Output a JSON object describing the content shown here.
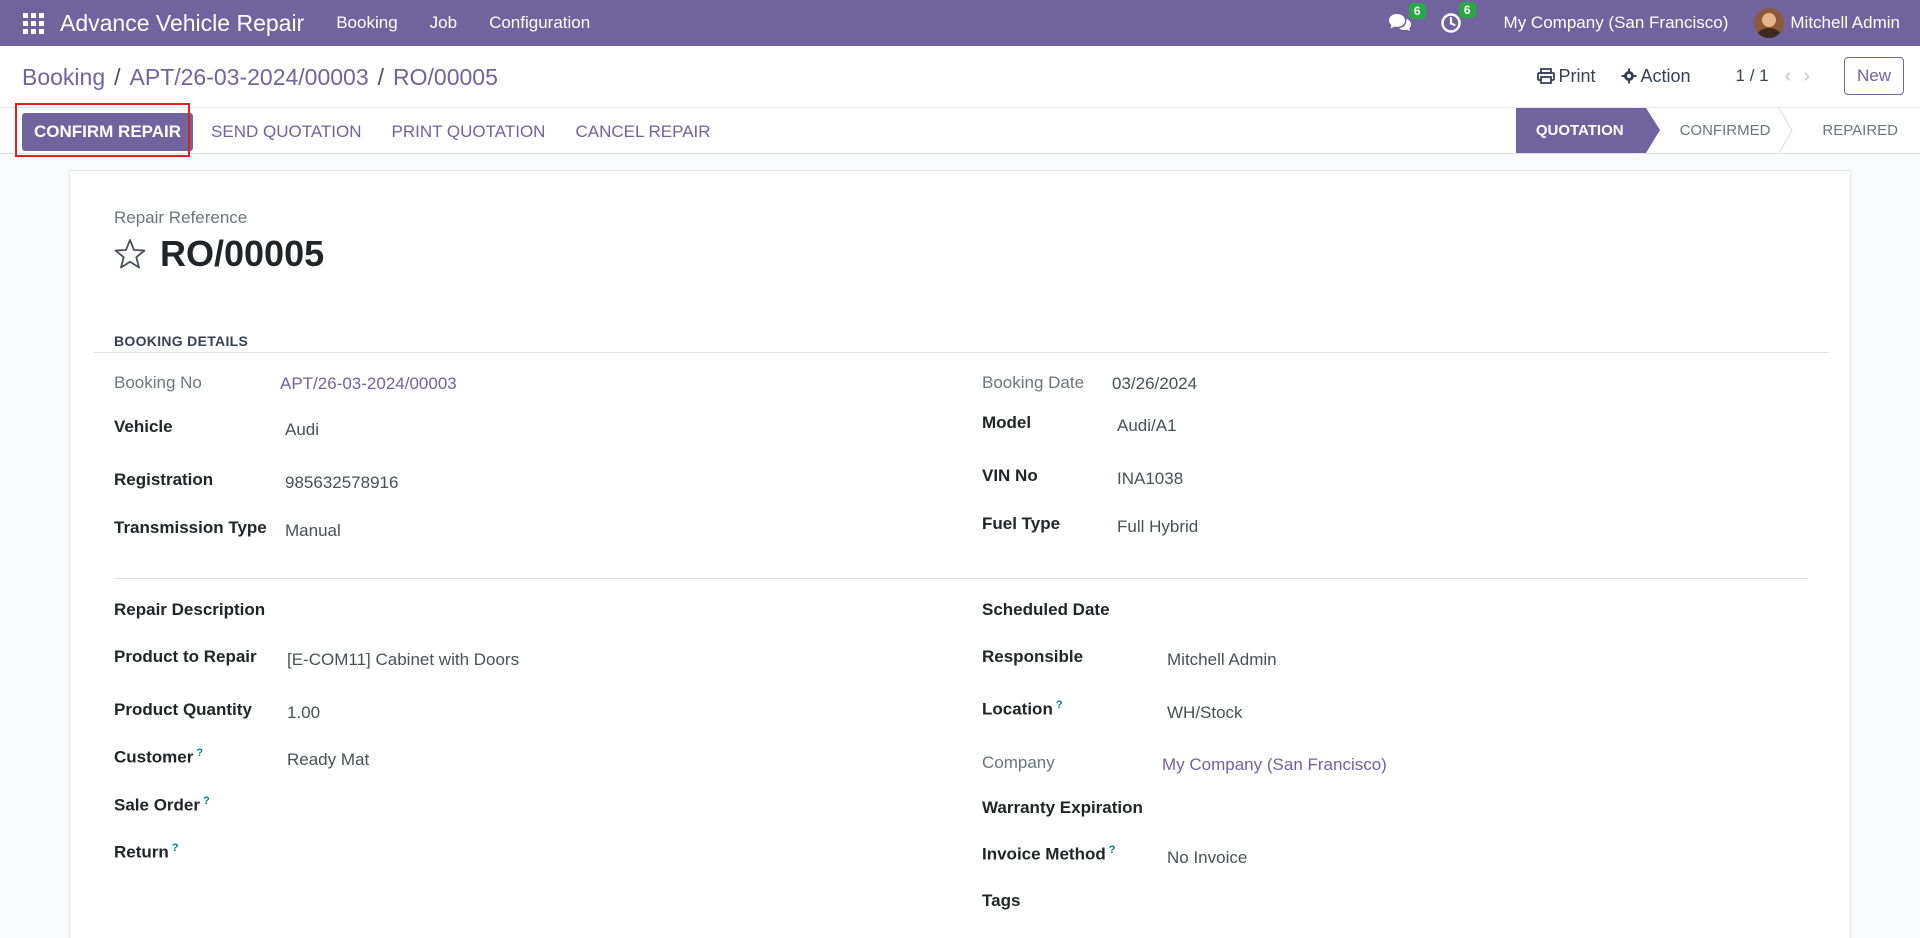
{
  "navbar": {
    "app_name": "Advance Vehicle Repair",
    "menu": [
      "Booking",
      "Job",
      "Configuration"
    ],
    "messages_count": "6",
    "activities_count": "6",
    "company": "My Company (San Francisco)",
    "user": "Mitchell Admin",
    "brand_color": "#71639e"
  },
  "breadcrumb": {
    "items": [
      "Booking",
      "APT/26-03-2024/00003"
    ],
    "current": "RO/00005",
    "separator": "/"
  },
  "control": {
    "print_label": "Print",
    "action_label": "Action",
    "pager": "1 / 1",
    "new_label": "New"
  },
  "actions": {
    "confirm": "CONFIRM REPAIR",
    "send_quotation": "SEND QUOTATION",
    "print_quotation": "PRINT QUOTATION",
    "cancel": "CANCEL REPAIR"
  },
  "stages": {
    "quotation": "QUOTATION",
    "confirmed": "CONFIRMED",
    "repaired": "REPAIRED",
    "active": "QUOTATION"
  },
  "form": {
    "reference_label": "Repair Reference",
    "reference": "RO/00005",
    "section_booking": "BOOKING DETAILS",
    "booking_no_label": "Booking No",
    "booking_no": "APT/26-03-2024/00003",
    "booking_date_label": "Booking Date",
    "booking_date": "03/26/2024",
    "vehicle_label": "Vehicle",
    "vehicle": "Audi",
    "model_label": "Model",
    "model": "Audi/A1",
    "registration_label": "Registration",
    "registration": "985632578916",
    "vin_label": "VIN No",
    "vin": "INA1038",
    "transmission_label": "Transmission Type",
    "transmission": "Manual",
    "fuel_label": "Fuel Type",
    "fuel": "Full Hybrid",
    "repair_desc_label": "Repair Description",
    "scheduled_label": "Scheduled Date",
    "product_label": "Product to Repair",
    "product": "[E-COM11] Cabinet with Doors",
    "responsible_label": "Responsible",
    "responsible": "Mitchell Admin",
    "qty_label": "Product Quantity",
    "qty": "1.00",
    "location_label": "Location",
    "location": "WH/Stock",
    "customer_label": "Customer",
    "customer": "Ready Mat",
    "company_label": "Company",
    "company": "My Company (San Francisco)",
    "sale_order_label": "Sale Order",
    "warranty_label": "Warranty Expiration",
    "return_label": "Return",
    "invoice_label": "Invoice Method",
    "invoice": "No Invoice",
    "tags_label": "Tags",
    "help_mark": "?"
  }
}
